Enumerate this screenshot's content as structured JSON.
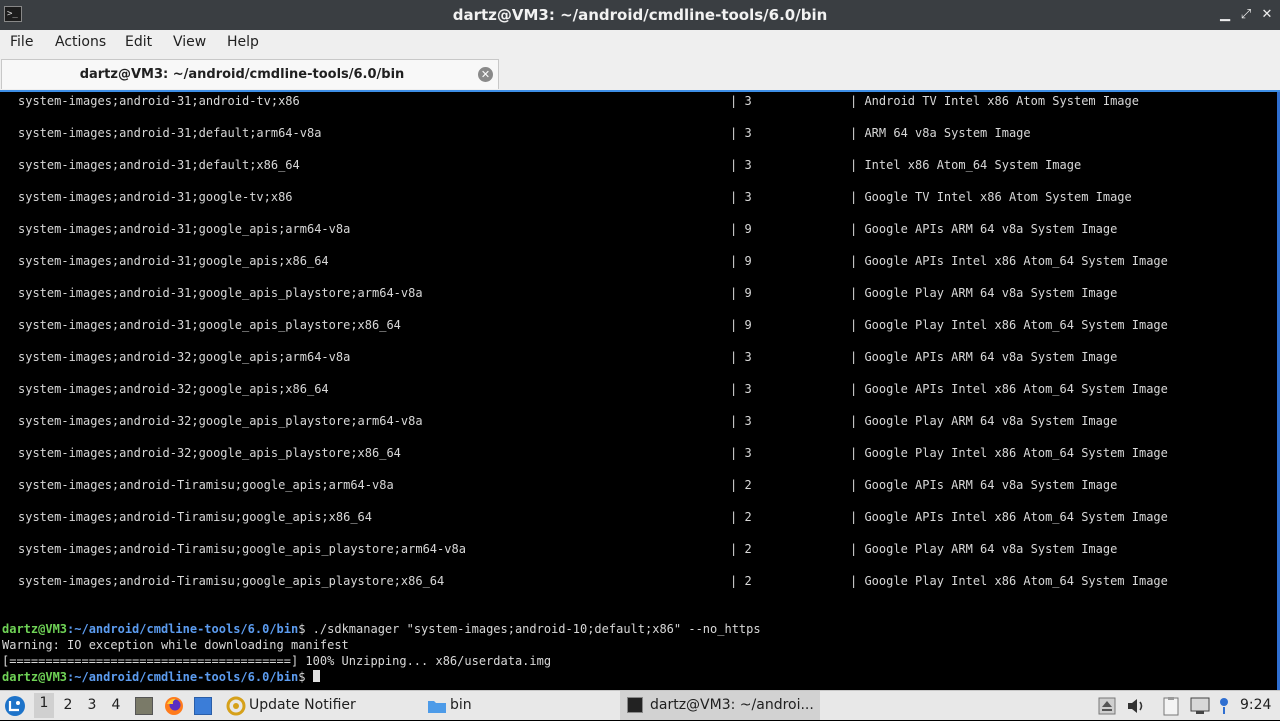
{
  "window": {
    "title": "dartz@VM3: ~/android/cmdline-tools/6.0/bin",
    "minimize_glyph": "▁",
    "maximize_glyph": "⤢",
    "close_glyph": "✕"
  },
  "menu": [
    "File",
    "Actions",
    "Edit",
    "View",
    "Help"
  ],
  "tab": {
    "label": "dartz@VM3: ~/android/cmdline-tools/6.0/bin",
    "close_glyph": "✕"
  },
  "terminal": {
    "rows": [
      {
        "pkg": "system-images;android-31;android-tv;x86",
        "ver": "| 3",
        "desc": "| Android TV Intel x86 Atom System Image"
      },
      {
        "pkg": "system-images;android-31;default;arm64-v8a",
        "ver": "| 3",
        "desc": "| ARM 64 v8a System Image"
      },
      {
        "pkg": "system-images;android-31;default;x86_64",
        "ver": "| 3",
        "desc": "| Intel x86 Atom_64 System Image"
      },
      {
        "pkg": "system-images;android-31;google-tv;x86",
        "ver": "| 3",
        "desc": "| Google TV Intel x86 Atom System Image"
      },
      {
        "pkg": "system-images;android-31;google_apis;arm64-v8a",
        "ver": "| 9",
        "desc": "| Google APIs ARM 64 v8a System Image"
      },
      {
        "pkg": "system-images;android-31;google_apis;x86_64",
        "ver": "| 9",
        "desc": "| Google APIs Intel x86 Atom_64 System Image"
      },
      {
        "pkg": "system-images;android-31;google_apis_playstore;arm64-v8a",
        "ver": "| 9",
        "desc": "| Google Play ARM 64 v8a System Image"
      },
      {
        "pkg": "system-images;android-31;google_apis_playstore;x86_64",
        "ver": "| 9",
        "desc": "| Google Play Intel x86 Atom_64 System Image"
      },
      {
        "pkg": "system-images;android-32;google_apis;arm64-v8a",
        "ver": "| 3",
        "desc": "| Google APIs ARM 64 v8a System Image"
      },
      {
        "pkg": "system-images;android-32;google_apis;x86_64",
        "ver": "| 3",
        "desc": "| Google APIs Intel x86 Atom_64 System Image"
      },
      {
        "pkg": "system-images;android-32;google_apis_playstore;arm64-v8a",
        "ver": "| 3",
        "desc": "| Google Play ARM 64 v8a System Image"
      },
      {
        "pkg": "system-images;android-32;google_apis_playstore;x86_64",
        "ver": "| 3",
        "desc": "| Google Play Intel x86 Atom_64 System Image"
      },
      {
        "pkg": "system-images;android-Tiramisu;google_apis;arm64-v8a",
        "ver": "| 2",
        "desc": "| Google APIs ARM 64 v8a System Image"
      },
      {
        "pkg": "system-images;android-Tiramisu;google_apis;x86_64",
        "ver": "| 2",
        "desc": "| Google APIs Intel x86 Atom_64 System Image"
      },
      {
        "pkg": "system-images;android-Tiramisu;google_apis_playstore;arm64-v8a",
        "ver": "| 2",
        "desc": "| Google Play ARM 64 v8a System Image"
      },
      {
        "pkg": "system-images;android-Tiramisu;google_apis_playstore;x86_64",
        "ver": "| 2",
        "desc": "| Google Play Intel x86 Atom_64 System Image"
      }
    ],
    "prompt_user": "dartz@VM3",
    "prompt_path": ":~/android/cmdline-tools/6.0/bin",
    "prompt_symbol": "$ ",
    "command": "./sdkmanager \"system-images;android-10;default;x86\" --no_https",
    "warning": "Warning: IO exception while downloading manifest",
    "progress": "[=======================================] 100% Unzipping... x86/userdata.img",
    "colors": {
      "user": "#6fd356",
      "path": "#5c9cf0",
      "accent": "#3d8ee6"
    }
  },
  "taskbar": {
    "workspaces": [
      "1",
      "2",
      "3",
      "4"
    ],
    "active_workspace": "1",
    "update_notifier_label": "Update Notifier",
    "bin_label": "bin",
    "terminal_task_label": "dartz@VM3: ~/androi...",
    "clock": "9:24"
  }
}
